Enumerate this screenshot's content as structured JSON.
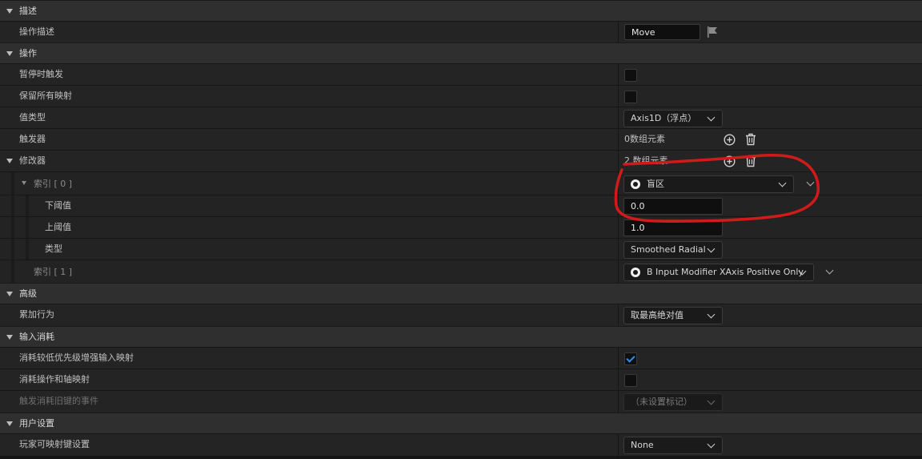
{
  "sections": {
    "description": "描述",
    "action": "操作",
    "advanced": "高级",
    "input_consumption": "输入消耗",
    "user_settings": "用户设置"
  },
  "props": {
    "action_description": {
      "label": "操作描述",
      "value": "Move"
    },
    "trigger_when_paused": {
      "label": "暂停时触发",
      "checked": false
    },
    "reserve_all_mappings": {
      "label": "保留所有映射",
      "checked": false
    },
    "value_type": {
      "label": "值类型",
      "value": "Axis1D（浮点）"
    },
    "triggers": {
      "label": "触发器",
      "count_text": "0数组元素"
    },
    "modifiers": {
      "label": "修改器",
      "count_text": "2 数组元素"
    },
    "index0": {
      "label": "索引 [ 0 ]",
      "value": "盲区"
    },
    "lower_threshold": {
      "label": "下阈值",
      "value": "0.0"
    },
    "upper_threshold": {
      "label": "上阈值",
      "value": "1.0"
    },
    "type": {
      "label": "类型",
      "value": "Smoothed Radial"
    },
    "index1": {
      "label": "索引 [ 1 ]",
      "value": "B Input Modifier XAxis Positive Only"
    },
    "accumulation_behavior": {
      "label": "累加行为",
      "value": "取最高绝对值"
    },
    "consume_lower_priority": {
      "label": "消耗较低优先级增强输入映射",
      "checked": true
    },
    "consume_action_axis": {
      "label": "消耗操作和轴映射",
      "checked": false
    },
    "trigger_consumed_legacy": {
      "label": "触发消耗旧键的事件",
      "value": "（未设置标记）"
    },
    "player_mappable_key": {
      "label": "玩家可映射键设置",
      "value": "None"
    }
  },
  "colors": {
    "accent_check": "#2f8df2",
    "annotation": "#d11a1a"
  }
}
